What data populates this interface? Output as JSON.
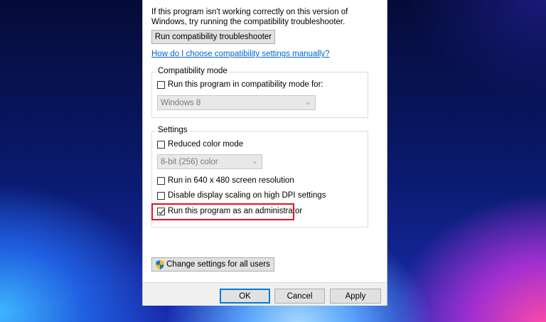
{
  "intro_text": "If this program isn't working correctly on this version of Windows, try running the compatibility troubleshooter.",
  "troubleshooter_button": "Run compatibility troubleshooter",
  "help_link": "How do I choose compatibility settings manually?",
  "compat_mode": {
    "title": "Compatibility mode",
    "checkbox_label": "Run this program in compatibility mode for:",
    "checked": false,
    "select_value": "Windows 8"
  },
  "settings": {
    "title": "Settings",
    "reduced_color": {
      "label": "Reduced color mode",
      "checked": false
    },
    "color_select": "8-bit (256) color",
    "res_640": {
      "label": "Run in 640 x 480 screen resolution",
      "checked": false
    },
    "dpi_scaling": {
      "label": "Disable display scaling on high DPI settings",
      "checked": false
    },
    "run_admin": {
      "label": "Run this program as an administrator",
      "checked": true
    }
  },
  "change_all_users_button": "Change settings for all users",
  "footer": {
    "ok": "OK",
    "cancel": "Cancel",
    "apply": "Apply"
  },
  "colors": {
    "highlight_border": "#e81123",
    "link": "#0066cc",
    "primary_border": "#0078d7"
  },
  "icons": {
    "shield": "uac-shield-icon",
    "dropdown": "chevron-down-icon"
  }
}
